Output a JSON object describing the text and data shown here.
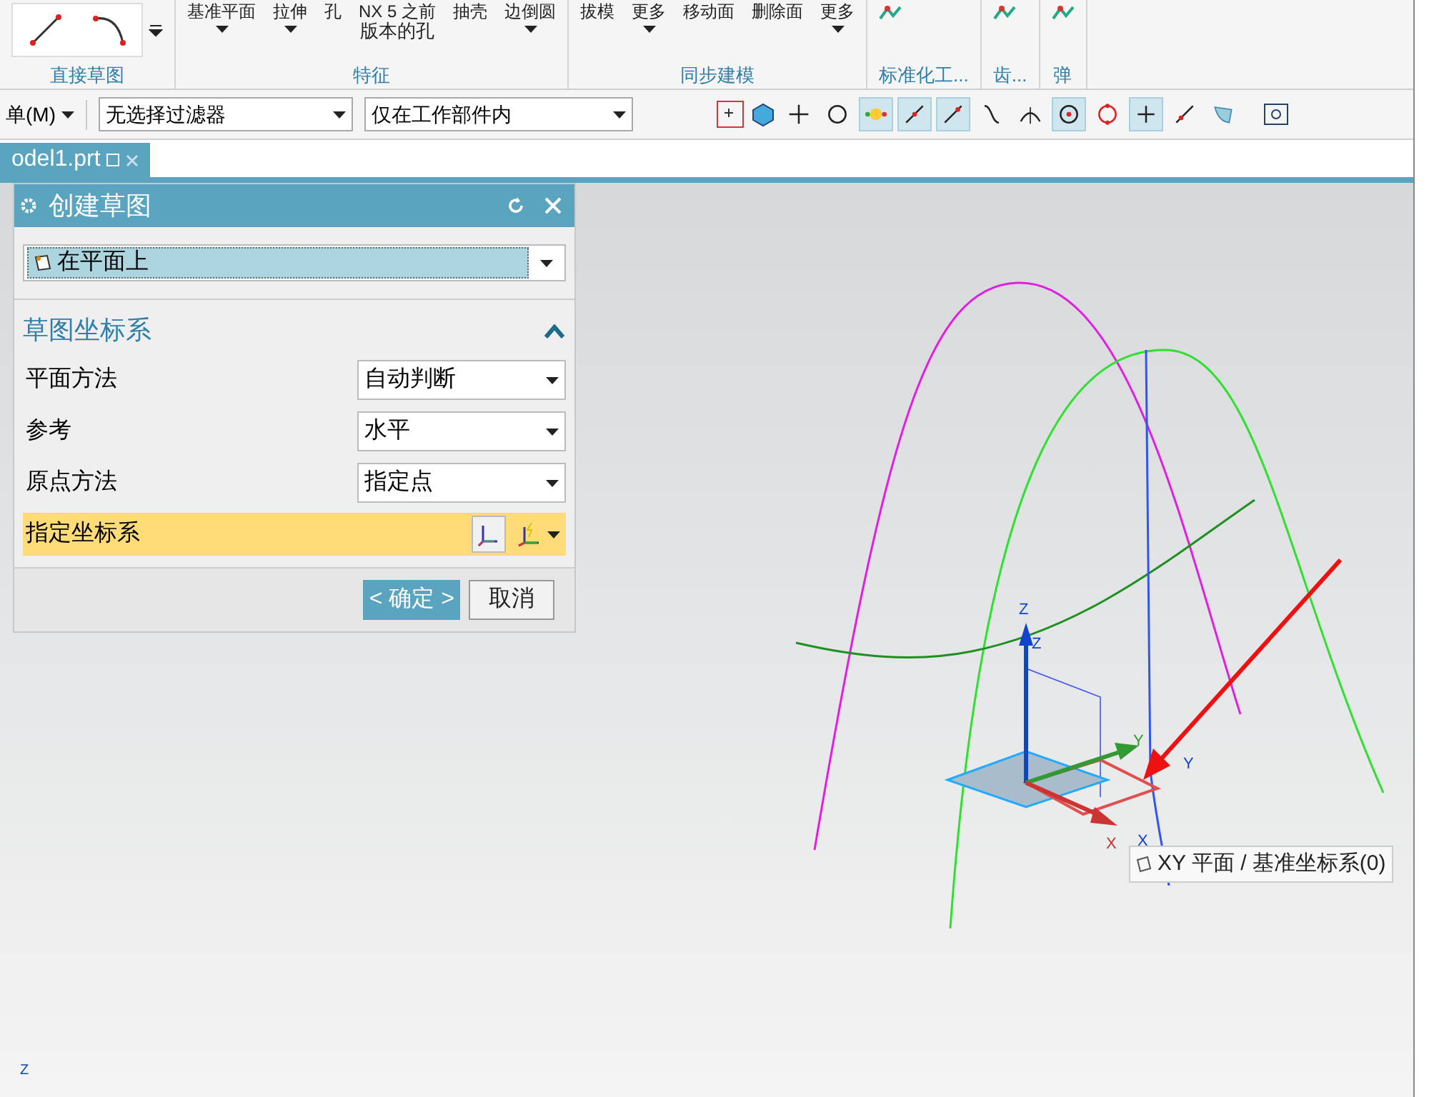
{
  "ribbon": {
    "groups": [
      {
        "label": "直接草图",
        "kind": "sketch"
      },
      {
        "label": "特征",
        "kind": "buttons",
        "items": [
          {
            "label": "基准平面",
            "caret": true
          },
          {
            "label": "拉伸",
            "caret": true
          },
          {
            "label": "孔",
            "caret": false
          },
          {
            "label": "NX 5 之前",
            "sub": "版本的孔",
            "caret": false
          },
          {
            "label": "抽壳",
            "caret": false
          },
          {
            "label": "边倒圆",
            "caret": true
          }
        ]
      },
      {
        "label": "同步建模",
        "kind": "buttons",
        "items": [
          {
            "label": "拔模",
            "caret": false
          },
          {
            "label": "更多",
            "caret": true
          },
          {
            "label": "移动面",
            "caret": false
          },
          {
            "label": "删除面",
            "caret": false
          },
          {
            "label": "更多",
            "caret": true
          }
        ]
      },
      {
        "label": "标准化工...",
        "kind": "icons"
      },
      {
        "label": "齿...",
        "kind": "icons"
      },
      {
        "label": "弹",
        "kind": "icons"
      }
    ]
  },
  "toolbar": {
    "menu": "单(M)",
    "filter": "无选择过滤器",
    "scope": "仅在工作部件内",
    "snap_tools": [
      {
        "selected": false
      },
      {
        "selected": false
      },
      {
        "selected": true
      },
      {
        "selected": true
      },
      {
        "selected": true
      },
      {
        "selected": false
      },
      {
        "selected": false
      },
      {
        "selected": true
      },
      {
        "selected": false
      },
      {
        "selected": true
      },
      {
        "selected": false
      },
      {
        "selected": false
      }
    ]
  },
  "tabs": [
    {
      "label": "odel1.prt",
      "selected": true
    }
  ],
  "dialog": {
    "title": "创建草图",
    "type": "在平面上",
    "section": {
      "title": "草图坐标系",
      "expanded": true,
      "rows": [
        {
          "label": "平面方法",
          "kind": "dropdown",
          "value": "自动判断",
          "highlighted": false
        },
        {
          "label": "参考",
          "kind": "dropdown",
          "value": "水平",
          "highlighted": false
        },
        {
          "label": "原点方法",
          "kind": "dropdown",
          "value": "指定点",
          "highlighted": false
        },
        {
          "label": "指定坐标系",
          "kind": "selector",
          "highlighted": true
        }
      ]
    },
    "buttons": [
      {
        "label": "< 确定 >",
        "primary": true
      },
      {
        "label": "取消",
        "primary": false
      }
    ]
  },
  "viewport": {
    "axis_labels": {
      "z": "Z",
      "z2": "Z",
      "y": "Y",
      "y2": "Y",
      "x": "X",
      "x2": "X"
    },
    "tooltip": "XY 平面 / 基准坐标系(0)",
    "triad_label": "Z"
  }
}
